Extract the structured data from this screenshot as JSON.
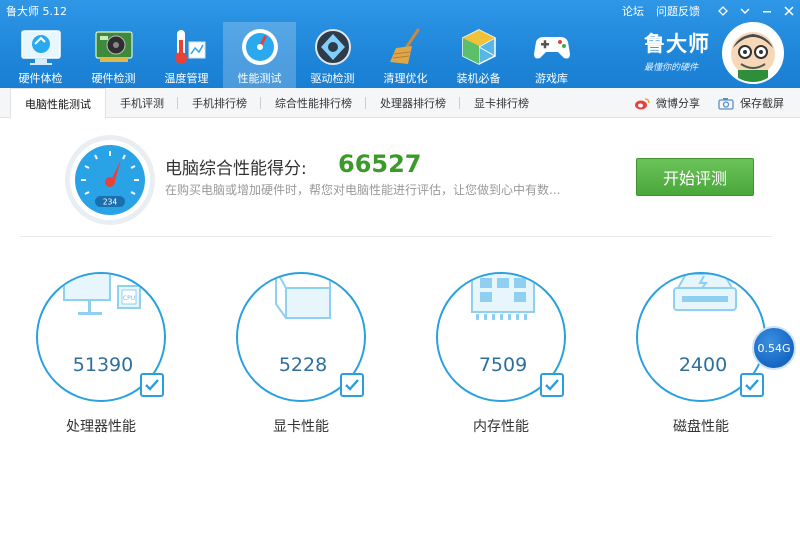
{
  "app": {
    "title": "鲁大师  5.12"
  },
  "window": {
    "links": [
      "论坛",
      "问题反馈"
    ]
  },
  "nav": [
    {
      "label": "硬件体检",
      "icon": "hardware-checkup-icon"
    },
    {
      "label": "硬件检测",
      "icon": "hardware-detect-icon"
    },
    {
      "label": "温度管理",
      "icon": "temperature-icon"
    },
    {
      "label": "性能测试",
      "icon": "performance-icon",
      "active": true
    },
    {
      "label": "驱动检测",
      "icon": "driver-icon"
    },
    {
      "label": "清理优化",
      "icon": "broom-icon"
    },
    {
      "label": "装机必备",
      "icon": "software-box-icon"
    },
    {
      "label": "游戏库",
      "icon": "gamepad-icon"
    }
  ],
  "brand": {
    "name": "鲁大师",
    "slogan": "最懂你的硬件"
  },
  "subtabs": [
    {
      "label": "电脑性能测试",
      "active": true
    },
    {
      "label": "手机评测"
    },
    {
      "label": "手机排行榜"
    },
    {
      "label": "综合性能排行榜"
    },
    {
      "label": "处理器排行榜"
    },
    {
      "label": "显卡排行榜"
    }
  ],
  "share": {
    "weibo": "微博分享",
    "screenshot": "保存截屏"
  },
  "score": {
    "title": "电脑综合性能得分:",
    "value": "66527",
    "description": "在购买电脑或增加硬件时，帮您对电脑性能进行评估，让您做到心中有数...",
    "gauge_digits": "234"
  },
  "start_button": "开始评测",
  "components": [
    {
      "label": "处理器性能",
      "value": "51390",
      "icon": "cpu-monitor-icon"
    },
    {
      "label": "显卡性能",
      "value": "5228",
      "icon": "gpu-cube-icon"
    },
    {
      "label": "内存性能",
      "value": "7509",
      "icon": "memory-chip-icon"
    },
    {
      "label": "磁盘性能",
      "value": "2400",
      "icon": "disk-drive-icon"
    }
  ],
  "memory_badge": "0.54G",
  "colors": {
    "header": "#1f86d9",
    "score": "#3c9a2a",
    "button": "#4aa73a",
    "ring": "#29a0e0"
  }
}
